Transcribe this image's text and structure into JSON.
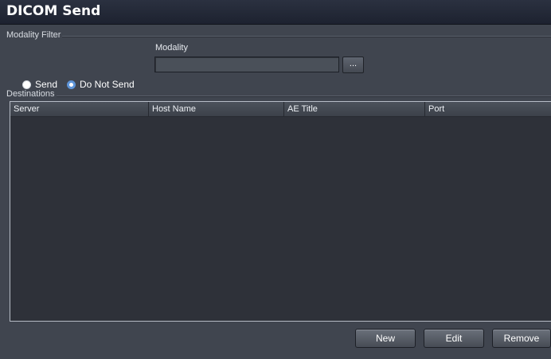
{
  "window": {
    "title": "DICOM Send"
  },
  "modality_filter": {
    "legend": "Modality Filter",
    "options": [
      {
        "label": "Send",
        "selected": false
      },
      {
        "label": "Do Not Send",
        "selected": true
      }
    ],
    "modality_label": "Modality",
    "modality_value": "",
    "browse_label": "..."
  },
  "destinations": {
    "legend": "Destinations",
    "columns": [
      "Server",
      "Host Name",
      "AE Title",
      "Port"
    ],
    "rows": []
  },
  "actions": {
    "new": "New",
    "edit": "Edit",
    "remove": "Remove"
  },
  "colors": {
    "background": "#40454f",
    "titlebar": "#1d2230",
    "list_bg": "#2e3139",
    "radio_accent": "#5d94d8"
  }
}
